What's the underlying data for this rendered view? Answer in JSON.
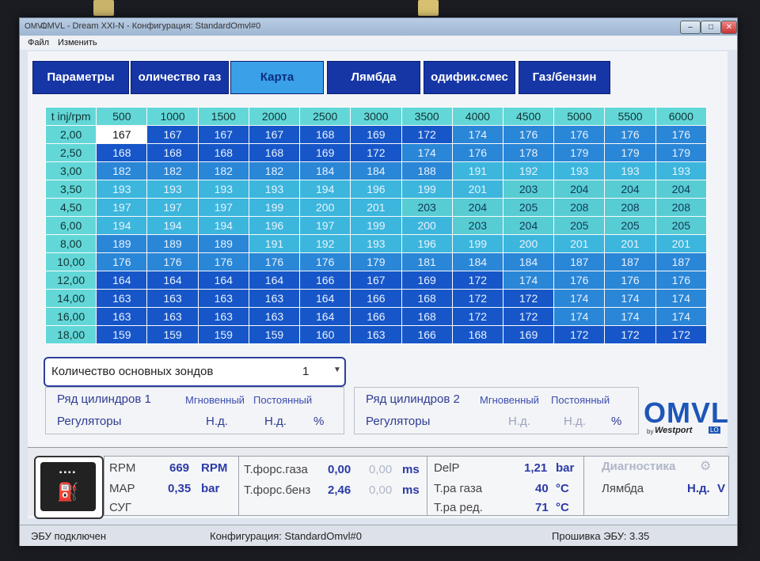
{
  "window": {
    "title": "OMVL - Dream XXI-N - Конфигурация: StandardOmvl#0",
    "app_icon": "OMVL",
    "buttons": {
      "minimize": "–",
      "maximize": "□",
      "close": "✕"
    }
  },
  "menu": [
    "Файл",
    "Изменить"
  ],
  "tabs": [
    {
      "label": "Параметры",
      "active": false
    },
    {
      "label": "оличество газ",
      "active": false
    },
    {
      "label": "Карта",
      "active": true
    },
    {
      "label": "Лямбда",
      "active": false
    },
    {
      "label": "одифик.смес",
      "active": false
    },
    {
      "label": "Газ/бензин",
      "active": false
    }
  ],
  "map_table": {
    "corner": "t inj/rpm",
    "rpm": [
      "500",
      "1000",
      "1500",
      "2000",
      "2500",
      "3000",
      "3500",
      "4000",
      "4500",
      "5000",
      "5500",
      "6000"
    ],
    "rows": [
      {
        "t": "2,00",
        "v": [
          "167",
          "167",
          "167",
          "167",
          "168",
          "169",
          "172",
          "174",
          "176",
          "176",
          "176",
          "176"
        ]
      },
      {
        "t": "2,50",
        "v": [
          "168",
          "168",
          "168",
          "168",
          "169",
          "172",
          "174",
          "176",
          "178",
          "179",
          "179",
          "179"
        ]
      },
      {
        "t": "3,00",
        "v": [
          "182",
          "182",
          "182",
          "182",
          "184",
          "184",
          "188",
          "191",
          "192",
          "193",
          "193",
          "193"
        ]
      },
      {
        "t": "3,50",
        "v": [
          "193",
          "193",
          "193",
          "193",
          "194",
          "196",
          "199",
          "201",
          "203",
          "204",
          "204",
          "204"
        ]
      },
      {
        "t": "4,50",
        "v": [
          "197",
          "197",
          "197",
          "199",
          "200",
          "201",
          "203",
          "204",
          "205",
          "208",
          "208",
          "208"
        ]
      },
      {
        "t": "6,00",
        "v": [
          "194",
          "194",
          "194",
          "196",
          "197",
          "199",
          "200",
          "203",
          "204",
          "205",
          "205",
          "205"
        ]
      },
      {
        "t": "8,00",
        "v": [
          "189",
          "189",
          "189",
          "191",
          "192",
          "193",
          "196",
          "199",
          "200",
          "201",
          "201",
          "201"
        ]
      },
      {
        "t": "10,00",
        "v": [
          "176",
          "176",
          "176",
          "176",
          "176",
          "179",
          "181",
          "184",
          "184",
          "187",
          "187",
          "187"
        ]
      },
      {
        "t": "12,00",
        "v": [
          "164",
          "164",
          "164",
          "164",
          "166",
          "167",
          "169",
          "172",
          "174",
          "176",
          "176",
          "176"
        ]
      },
      {
        "t": "14,00",
        "v": [
          "163",
          "163",
          "163",
          "163",
          "164",
          "166",
          "168",
          "172",
          "172",
          "174",
          "174",
          "174"
        ]
      },
      {
        "t": "16,00",
        "v": [
          "163",
          "163",
          "163",
          "163",
          "164",
          "166",
          "168",
          "172",
          "172",
          "174",
          "174",
          "174"
        ]
      },
      {
        "t": "18,00",
        "v": [
          "159",
          "159",
          "159",
          "159",
          "160",
          "163",
          "166",
          "168",
          "169",
          "172",
          "172",
          "172"
        ]
      }
    ],
    "selected_cell": {
      "row": 0,
      "col": 0
    },
    "colors": {
      "dark": "#1756c8",
      "mid": "#2a86d6",
      "light": "#3cb6dc",
      "teal": "#58ccd3"
    }
  },
  "probes": {
    "label": "Количество основных зондов",
    "value": "1"
  },
  "bank1": {
    "title": "Ряд цилиндров 1",
    "instant": "Мгновенный",
    "constant": "Постоянный",
    "regulators": "Регуляторы",
    "v1": "Н.д.",
    "v2": "Н.д.",
    "unit": "%"
  },
  "bank2": {
    "title": "Ряд цилиндров 2",
    "instant": "Мгновенный",
    "constant": "Постоянный",
    "regulators": "Регуляторы",
    "v1": "Н.д.",
    "v2": "Н.д.",
    "unit": "%"
  },
  "logo": {
    "brand": "OMVL",
    "by": "by",
    "westport": "Westport",
    "lo": "LO"
  },
  "status": {
    "rpm_label": "RPM",
    "rpm_value": "669",
    "rpm_unit": "RPM",
    "map_label": "MAP",
    "map_value": "0,35",
    "map_unit": "bar",
    "sug_label": "СУГ",
    "gas_inj_label": "Т.форс.газа",
    "gas_inj_value": "0,00",
    "gas_inj_value2": "0,00",
    "gas_inj_unit": "ms",
    "pet_inj_label": "Т.форс.бенз",
    "pet_inj_value": "2,46",
    "pet_inj_value2": "0,00",
    "pet_inj_unit": "ms",
    "delp_label": "DelP",
    "delp_value": "1,21",
    "delp_unit": "bar",
    "tgas_label": "Т.ра газа",
    "tgas_value": "40",
    "tgas_unit": "°C",
    "tred_label": "Т.ра ред.",
    "tred_value": "71",
    "tred_unit": "°C",
    "diag_label": "Диагностика",
    "lambda_label": "Лямбда",
    "lambda_value": "Н.д.",
    "lambda_unit": "V"
  },
  "statusbar": {
    "ecu": "ЭБУ подключен",
    "config": "Конфигурация: StandardOmvl#0",
    "firmware": "Прошивка ЭБУ: 3.35"
  }
}
